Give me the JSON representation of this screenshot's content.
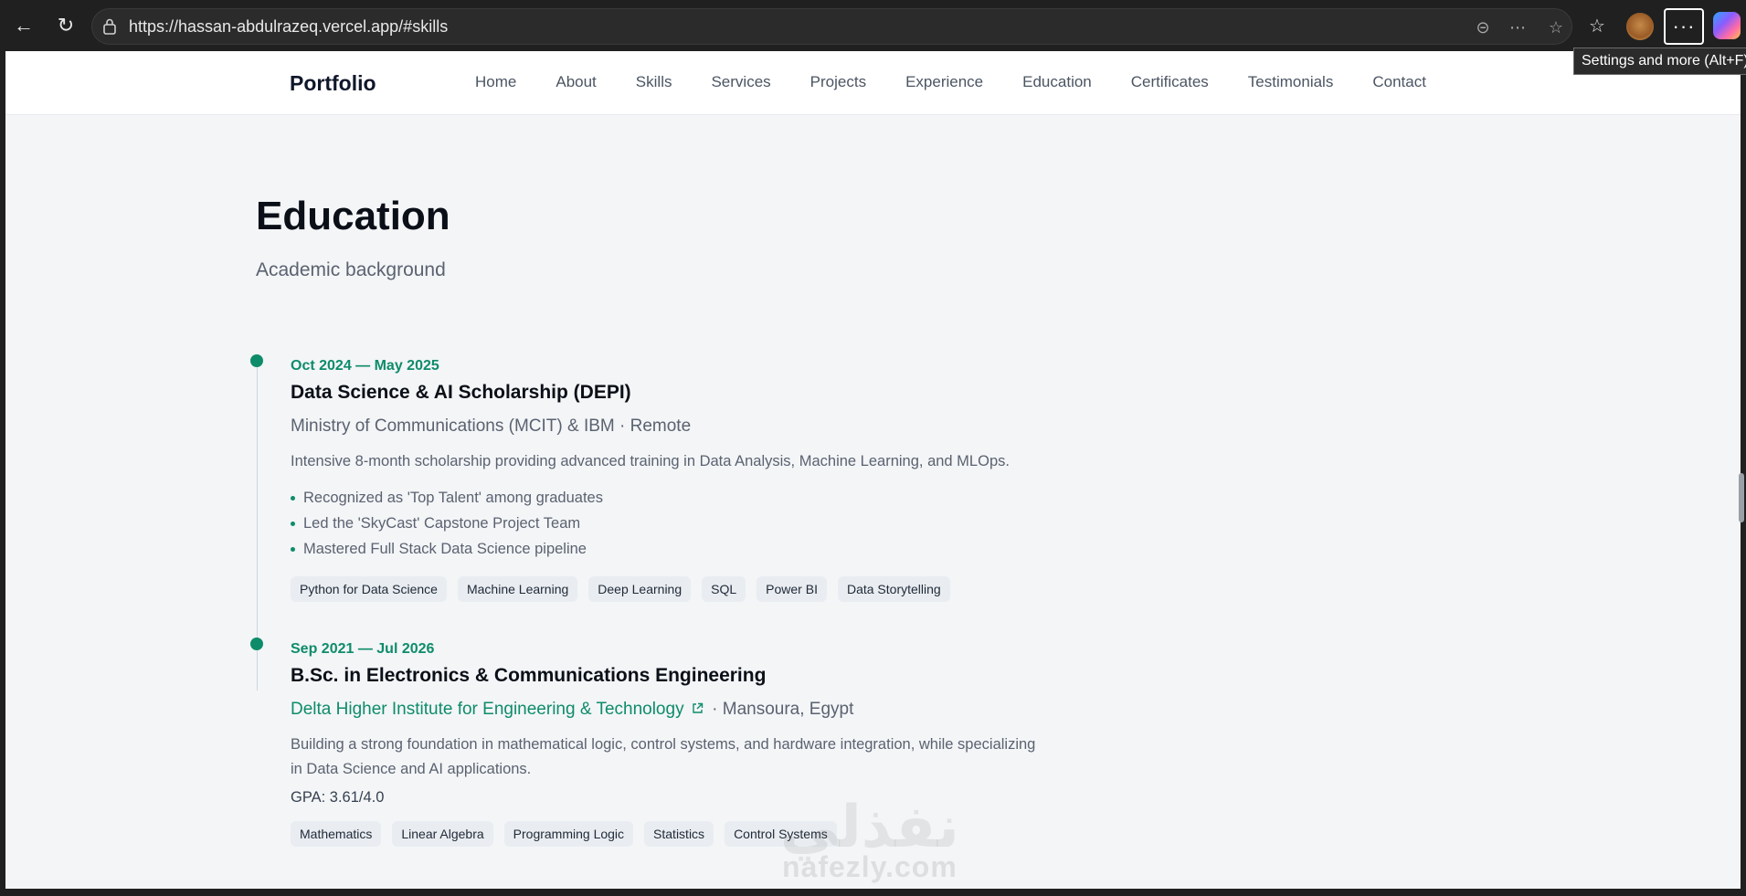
{
  "browser": {
    "url": "https://hassan-abdulrazeq.vercel.app/#skills",
    "tooltip": "Settings and more (Alt+F)"
  },
  "nav": {
    "brand": "Portfolio",
    "links": [
      "Home",
      "About",
      "Skills",
      "Services",
      "Projects",
      "Experience",
      "Education",
      "Certificates",
      "Testimonials",
      "Contact"
    ]
  },
  "section": {
    "title": "Education",
    "subtitle": "Academic background"
  },
  "entries": [
    {
      "date": "Oct 2024 — May 2025",
      "degree": "Data Science & AI Scholarship (DEPI)",
      "institution": "Ministry of Communications (MCIT) & IBM",
      "location": "· Remote",
      "description": "Intensive 8-month scholarship providing advanced training in Data Analysis, Machine Learning, and MLOps.",
      "bullets": [
        "Recognized as 'Top Talent' among graduates",
        "Led the 'SkyCast' Capstone Project Team",
        "Mastered Full Stack Data Science pipeline"
      ],
      "tags": [
        "Python for Data Science",
        "Machine Learning",
        "Deep Learning",
        "SQL",
        "Power BI",
        "Data Storytelling"
      ]
    },
    {
      "date": "Sep 2021 — Jul 2026",
      "degree": "B.Sc. in Electronics & Communications Engineering",
      "institution": "Delta Higher Institute for Engineering & Technology",
      "location": "· Mansoura, Egypt",
      "description": "Building a strong foundation in mathematical logic, control systems, and hardware integration, while specializing in Data Science and AI applications.",
      "gpa": "GPA: 3.61/4.0",
      "tags": [
        "Mathematics",
        "Linear Algebra",
        "Programming Logic",
        "Statistics",
        "Control Systems"
      ]
    }
  ],
  "watermark": {
    "arabic": "نفذلي",
    "latin": "nafezly.com"
  }
}
